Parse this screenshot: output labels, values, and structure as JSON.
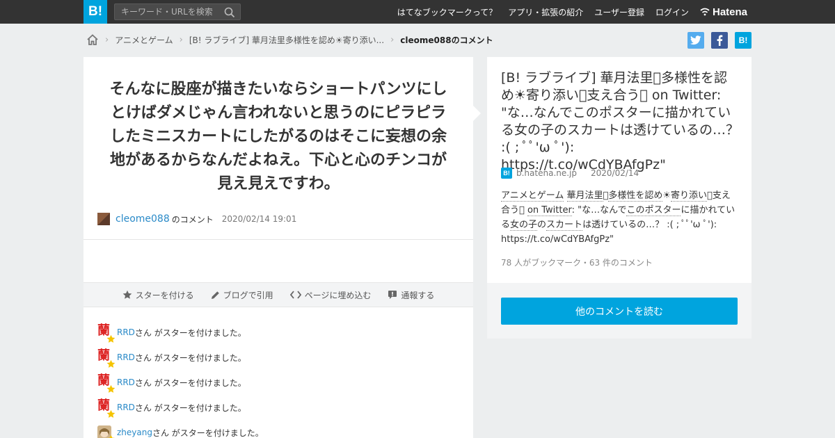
{
  "header": {
    "logo": "B!",
    "search_placeholder": "キーワード・URLを検索",
    "links": [
      "はてなブックマークって？",
      "アプリ・拡張の紹介",
      "ユーザー登録",
      "ログイン"
    ],
    "brand": "Hatena"
  },
  "breadcrumb": {
    "items": [
      "アニメとゲーム",
      "[B! ラブライブ] 華月法里多様性を認め☀寄り添い...",
      "cleome088のコメント"
    ]
  },
  "share_buttons": [
    "twitter",
    "facebook",
    "hatena-bookmark"
  ],
  "comment": {
    "text": "そんなに股座が描きたいならショートパンツにしとけばダメじゃん言われないと思うのにピラピラしたミニスカートにしたがるのはそこに妄想の余地があるからなんだよねえ。下心と心のチンコが見え見えですわ。",
    "user": "cleome088",
    "user_suffix": "のコメント",
    "time": "2020/02/14 19:01"
  },
  "actions": [
    "スターを付ける",
    "ブログで引用",
    "ページに埋め込む",
    "通報する"
  ],
  "stars": [
    {
      "user": "RRD",
      "text": "さん がスターを付けました。"
    },
    {
      "user": "RRD",
      "text": "さん がスターを付けました。"
    },
    {
      "user": "RRD",
      "text": "さん がスターを付けました。"
    },
    {
      "user": "RRD",
      "text": "さん がスターを付けました。"
    },
    {
      "user": "zheyang",
      "text": "さん がスターを付けました。"
    }
  ],
  "entry": {
    "title": "[B! ラブライブ] 華月法里􀀀多様性を認め☀寄り添い􀀀支え合う􀀀 on Twitter: \"な…なんでこのポスターに描かれている女の子のスカートは透けているの…？ :( ; ﾟﾟ'ω ﾟ'): https://t.co/wCdYBAfgPz\"",
    "domain": "b.hatena.ne.jp",
    "date": "2020/02/14",
    "desc_tags": [
      "アニメとゲーム",
      "華月法里",
      "多様性を認め",
      "寄り添い",
      "支え合う",
      "on Twitter",
      "このポスター",
      "女の子",
      "スカート"
    ],
    "desc_parts": [
      "",
      "アニメとゲーム",
      " ",
      "華月法里",
      "􀀀",
      "多様性を認め",
      "☀",
      "寄り添い",
      "􀀀支え合う􀀀 ",
      "on Twitter",
      ": \"な…なんで",
      "このポスター",
      "に描かれている",
      "女の子",
      "の",
      "スカート",
      "は透けているの…？ :( ; ﾟﾟ'ω ﾟ'): https://t.co/wCdYBAfgPz\""
    ],
    "count": "78 人がブックマーク・63 件のコメント"
  },
  "more_button": "他のコメントを読む",
  "colors": {
    "topbar": "#333333",
    "accent": "#00a4de",
    "link": "#2a8ac8",
    "page_bg": "#eceeef"
  }
}
